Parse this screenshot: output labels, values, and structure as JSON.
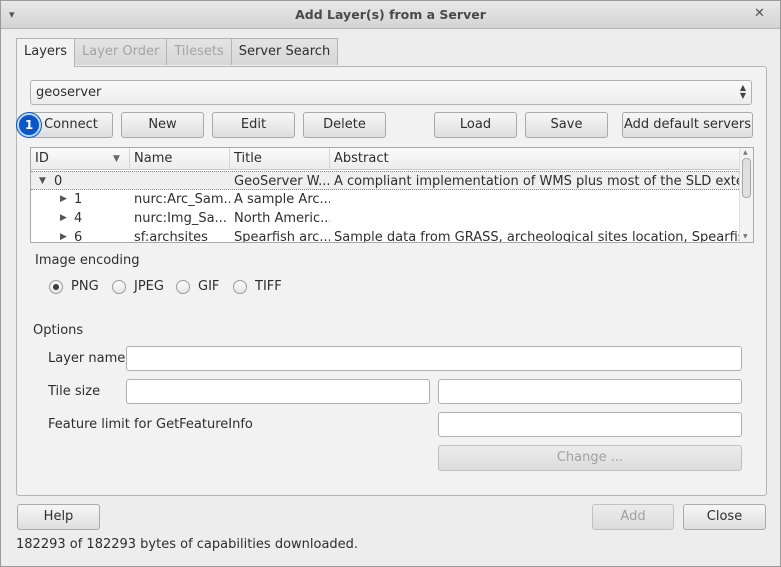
{
  "window": {
    "title": "Add Layer(s) from a Server"
  },
  "tabs": [
    {
      "label": "Layers"
    },
    {
      "label": "Layer Order"
    },
    {
      "label": "Tilesets"
    },
    {
      "label": "Server Search"
    }
  ],
  "connection": {
    "selected": "geoserver"
  },
  "marker": {
    "label": "1"
  },
  "buttons": {
    "connect": "Connect",
    "new": "New",
    "edit": "Edit",
    "delete": "Delete",
    "load": "Load",
    "save": "Save",
    "add_default": "Add default servers",
    "change": "Change ...",
    "help": "Help",
    "add": "Add",
    "close": "Close"
  },
  "tree": {
    "columns": [
      "ID",
      "Name",
      "Title",
      "Abstract"
    ],
    "rows": [
      {
        "id": "0",
        "name": "",
        "title": "GeoServer W...",
        "abstract": "A compliant implementation of WMS plus most of the SLD extens..."
      },
      {
        "id": "1",
        "name": "nurc:Arc_Sam...",
        "title": "A sample Arc...",
        "abstract": ""
      },
      {
        "id": "4",
        "name": "nurc:Img_Sa...",
        "title": "North Americ...",
        "abstract": ""
      },
      {
        "id": "6",
        "name": "sf:archsites",
        "title": "Spearfish arc...",
        "abstract": "Sample data from GRASS, archeological sites location, Spearfish, ..."
      }
    ]
  },
  "image_encoding": {
    "heading": "Image encoding",
    "options": [
      "PNG",
      "JPEG",
      "GIF",
      "TIFF"
    ],
    "selected": "PNG"
  },
  "options": {
    "heading": "Options",
    "layer_name_label": "Layer name",
    "tile_size_label": "Tile size",
    "feature_limit_label": "Feature limit for GetFeatureInfo",
    "layer_name_value": "",
    "tile_width_value": "",
    "tile_height_value": "",
    "feature_limit_value": ""
  },
  "status": "182293 of 182293 bytes of capabilities downloaded."
}
